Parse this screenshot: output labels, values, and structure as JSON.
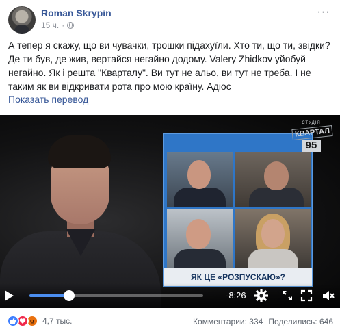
{
  "post": {
    "author": "Roman Skrypin",
    "time": "15 ч.",
    "separator": "·",
    "text": "А тепер я скажу, що ви чувачки, трошки підахуїли. Хто ти, що ти, звідки? Де ти був, де жив, вертайся негайно додому. Valery Zhidkov уйобуй негайно. Як і решта \"Кварталу\". Ви тут не альо, ви тут не треба. І не таким як ви відкривати рота про мою країну. Адіос",
    "translate_label": "Показать перевод",
    "more_label": "···"
  },
  "video": {
    "caption": "ЯК ЦЕ «РОЗПУСКАЮ»?",
    "logo_studio": "СТУДІЯ",
    "logo_name": "КВАРТАЛ",
    "logo_number": "95",
    "remaining_time": "-8:26",
    "progress_fraction": 0.23
  },
  "footer": {
    "reaction_count": "4,7 тыс.",
    "comments": "Комментарии: 334",
    "shares": "Поделились: 646"
  },
  "icons": {
    "reactions": [
      "like-icon",
      "love-icon",
      "angry-icon"
    ],
    "controls": [
      "play-icon",
      "gear-icon",
      "expand-icon",
      "fullscreen-icon",
      "volume-icon"
    ],
    "accent": "#385898",
    "progress_color": "#4b8ef0"
  }
}
